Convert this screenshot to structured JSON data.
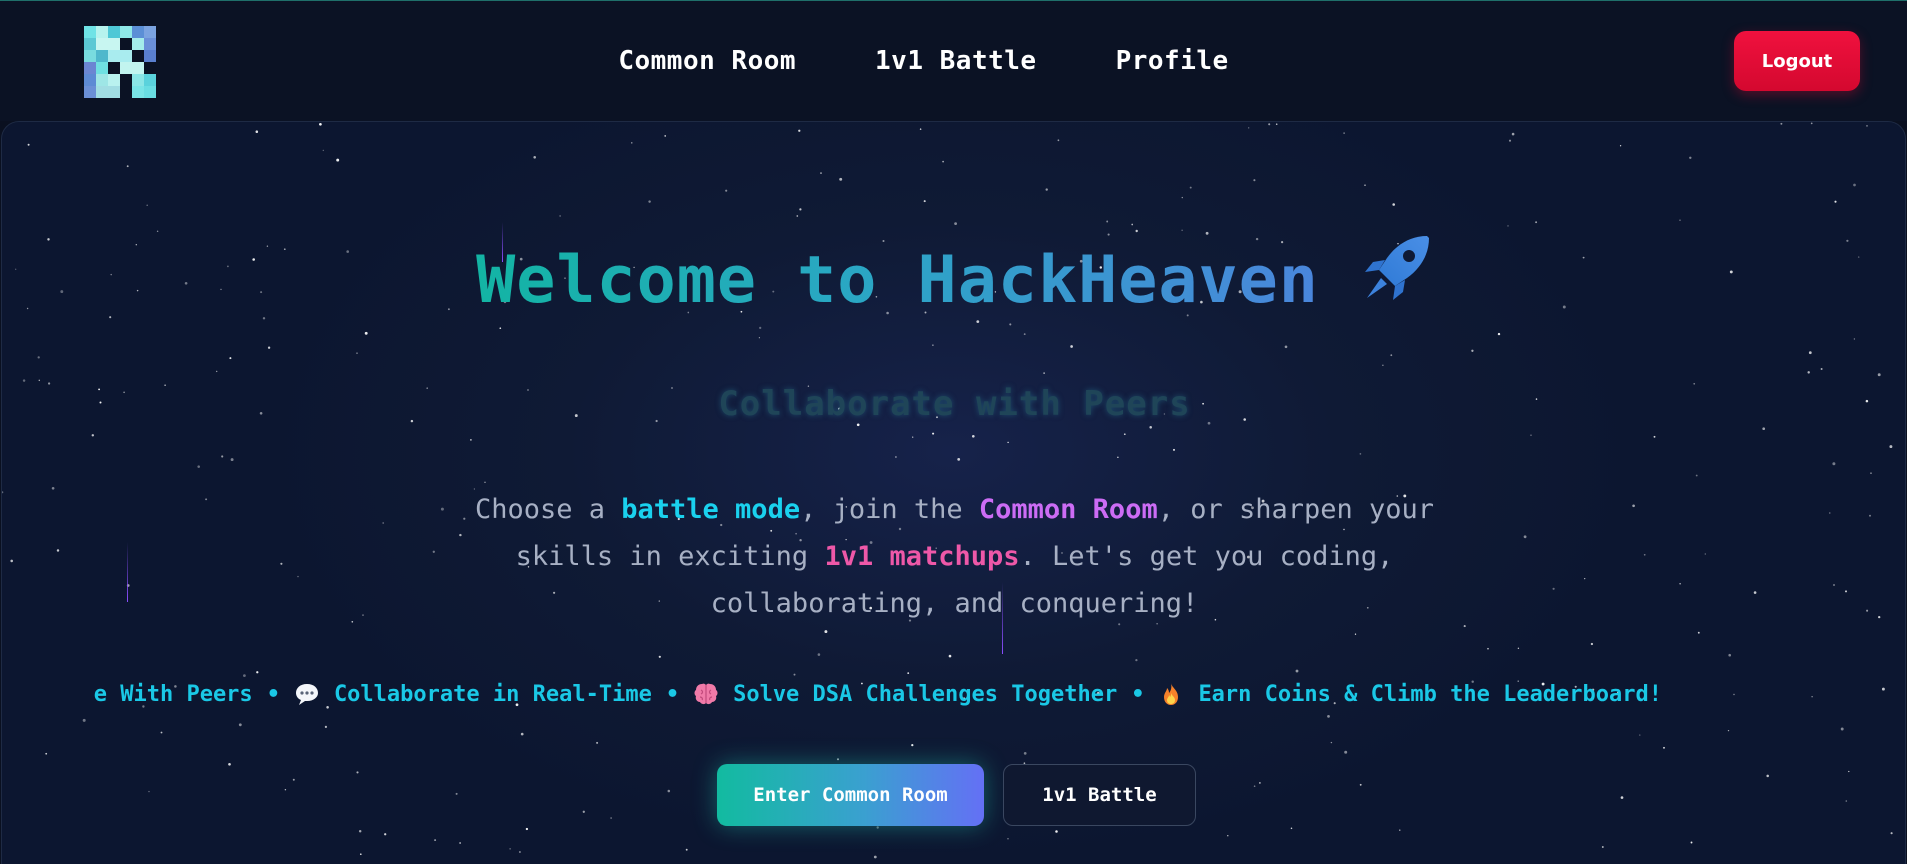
{
  "navbar": {
    "links": [
      {
        "label": "Common Room"
      },
      {
        "label": "1v1 Battle"
      },
      {
        "label": "Profile"
      }
    ],
    "logout_label": "Logout"
  },
  "hero": {
    "title": "Welcome to HackHeaven",
    "title_icon": "rocket-icon",
    "subtitle": "Collaborate with Peers",
    "description": {
      "part1": "Choose a ",
      "battle_mode": "battle mode",
      "part2": ", join the ",
      "common_room": "Common Room",
      "part3": ", or sharpen your skills in exciting ",
      "matchups": "1v1 matchups",
      "part4": ". Let's get you coding, collaborating, and conquering!"
    },
    "ticker": {
      "items": [
        {
          "icon": "",
          "text": "ttle With Peers"
        },
        {
          "icon": "speech-bubble-icon",
          "text": "Collaborate in Real-Time"
        },
        {
          "icon": "brain-icon",
          "text": "Solve DSA Challenges Together"
        },
        {
          "icon": "fire-icon",
          "text": "Earn Coins & Climb the Leaderboard!"
        }
      ],
      "separator": "•"
    },
    "buttons": {
      "primary": "Enter Common Room",
      "secondary": "1v1 Battle"
    }
  },
  "colors": {
    "background": "#0a1020",
    "accent_cyan": "#1ad1ee",
    "accent_purple": "#cc6cf5",
    "accent_pink": "#ee58a8",
    "logout_red": "#e80a3a"
  }
}
